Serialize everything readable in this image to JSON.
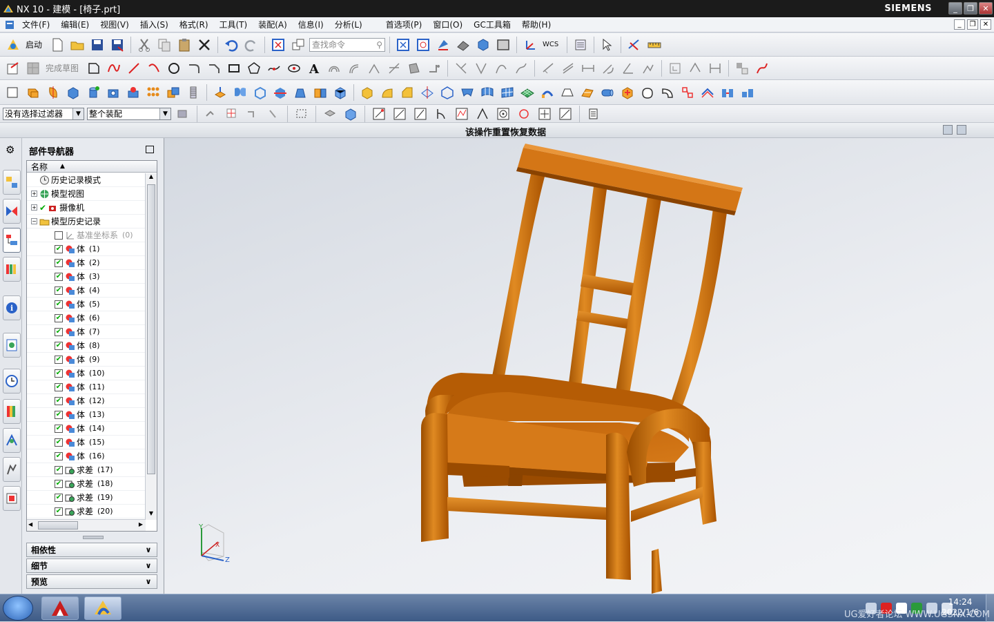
{
  "window": {
    "title": "NX 10 - 建模 - [椅子.prt]",
    "brand": "SIEMENS"
  },
  "menu": [
    "文件(F)",
    "编辑(E)",
    "视图(V)",
    "插入(S)",
    "格式(R)",
    "工具(T)",
    "装配(A)",
    "信息(I)",
    "分析(L)",
    "首选项(P)",
    "窗口(O)",
    "GC工具箱",
    "帮助(H)"
  ],
  "toolbar": {
    "start_label": "启动",
    "search_placeholder": "查找命令",
    "finish_sketch_label": "完成草图",
    "wcs_label": "WCS"
  },
  "selection": {
    "filter": "没有选择过滤器",
    "scope": "整个装配"
  },
  "cue": "该操作重置恢复数据",
  "navigator": {
    "title": "部件导航器",
    "column": "名称",
    "rows": [
      {
        "label": "历史记录模式",
        "num": "",
        "type": "history-mode",
        "indent": 1
      },
      {
        "label": "模型视图",
        "num": "",
        "type": "model-views",
        "indent": 0,
        "exp": "+"
      },
      {
        "label": "摄像机",
        "num": "",
        "type": "cameras",
        "indent": 0,
        "exp": "+"
      },
      {
        "label": "模型历史记录",
        "num": "",
        "type": "history-folder",
        "indent": 0,
        "exp": "−"
      },
      {
        "label": "基准坐标系",
        "num": "(0)",
        "type": "datum",
        "indent": 2,
        "dim": true
      },
      {
        "label": "体",
        "num": "(1)",
        "type": "body",
        "indent": 2
      },
      {
        "label": "体",
        "num": "(2)",
        "type": "body",
        "indent": 2
      },
      {
        "label": "体",
        "num": "(3)",
        "type": "body",
        "indent": 2
      },
      {
        "label": "体",
        "num": "(4)",
        "type": "body",
        "indent": 2
      },
      {
        "label": "体",
        "num": "(5)",
        "type": "body",
        "indent": 2
      },
      {
        "label": "体",
        "num": "(6)",
        "type": "body",
        "indent": 2
      },
      {
        "label": "体",
        "num": "(7)",
        "type": "body",
        "indent": 2
      },
      {
        "label": "体",
        "num": "(8)",
        "type": "body",
        "indent": 2
      },
      {
        "label": "体",
        "num": "(9)",
        "type": "body",
        "indent": 2
      },
      {
        "label": "体",
        "num": "(10)",
        "type": "body",
        "indent": 2
      },
      {
        "label": "体",
        "num": "(11)",
        "type": "body",
        "indent": 2
      },
      {
        "label": "体",
        "num": "(12)",
        "type": "body",
        "indent": 2
      },
      {
        "label": "体",
        "num": "(13)",
        "type": "body",
        "indent": 2
      },
      {
        "label": "体",
        "num": "(14)",
        "type": "body",
        "indent": 2
      },
      {
        "label": "体",
        "num": "(15)",
        "type": "body",
        "indent": 2
      },
      {
        "label": "体",
        "num": "(16)",
        "type": "body",
        "indent": 2
      },
      {
        "label": "求差",
        "num": "(17)",
        "type": "subtract",
        "indent": 2
      },
      {
        "label": "求差",
        "num": "(18)",
        "type": "subtract",
        "indent": 2
      },
      {
        "label": "求差",
        "num": "(19)",
        "type": "subtract",
        "indent": 2
      },
      {
        "label": "求差",
        "num": "(20)",
        "type": "subtract",
        "indent": 2
      }
    ],
    "sections": [
      "相依性",
      "细节",
      "预览"
    ]
  },
  "triad": {
    "x": "X",
    "y": "Y",
    "z": "Z"
  },
  "taskbar": {
    "time": "14:24",
    "date": "2022/1/6",
    "watermark": "UG爱好者论坛 WWW.UGSNX.COM"
  },
  "colors": {
    "wood": "#c86d10",
    "wood_dark": "#8a4300",
    "wood_light": "#e8942e",
    "titlebar": "#1b1b1b"
  }
}
